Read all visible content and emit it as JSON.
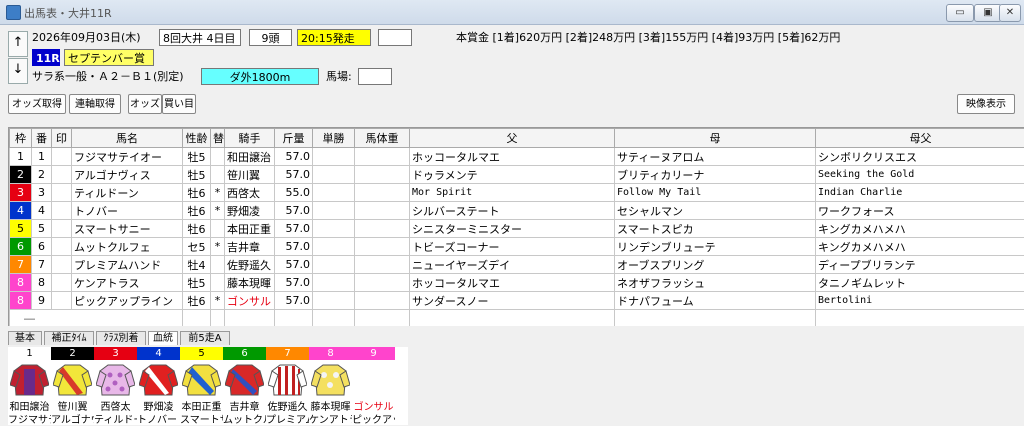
{
  "window": {
    "title": "出馬表・大井11R",
    "min_label": "▭",
    "max_label": "▣",
    "close_label": "✕"
  },
  "race": {
    "up_label": "↑",
    "down_label": "↓",
    "date": "2026年09月03日(木)",
    "meeting": "8回大井 4日目",
    "heads": "9頭",
    "start": "20:15発走",
    "extra": "",
    "race_no": "11R",
    "race_name": "セプテンバー賞",
    "conditions": "サラ系一般・Ａ２－Ｂ１(別定)",
    "course": "ダ外1800m",
    "baba_label": "馬場:",
    "baba_value": "",
    "prize": "本賞金 [1着]620万円 [2着]248万円 [3着]155万円 [4着]93万円 [5着]62万円"
  },
  "toolbar": {
    "odds_fetch": "オッズ取得",
    "ren_fetch": "連軸取得",
    "odds": "オッズ",
    "buy": "買い目",
    "video": "映像表示"
  },
  "table": {
    "headers": [
      "枠",
      "番",
      "印",
      "馬名",
      "性齢",
      "替",
      "騎手",
      "斤量",
      "単勝",
      "馬体重",
      "父",
      "母",
      "母父"
    ],
    "rows": [
      {
        "waku": "1",
        "ban": "1",
        "mark": "",
        "name": "フジマサテイオー",
        "sexage": "牡5",
        "kae": "",
        "jockey": "和田譲治",
        "kinryo": "57.0",
        "odds": "",
        "weight": "",
        "sire": "ホッコータルマエ",
        "dam": "サティーヌアロム",
        "damsire": "シンボリクリスエス"
      },
      {
        "waku": "2",
        "ban": "2",
        "mark": "",
        "name": "アルゴナヴィス",
        "sexage": "牡5",
        "kae": "",
        "jockey": "笹川翼",
        "kinryo": "57.0",
        "odds": "",
        "weight": "",
        "sire": "ドゥラメンテ",
        "dam": "ブリティカリーナ",
        "damsire": "Seeking the Gold"
      },
      {
        "waku": "3",
        "ban": "3",
        "mark": "",
        "name": "ティルドーン",
        "sexage": "牡6",
        "kae": "*",
        "jockey": "西啓太",
        "kinryo": "55.0",
        "odds": "",
        "weight": "",
        "sire": "Mor Spirit",
        "dam": "Follow My Tail",
        "damsire": "Indian Charlie"
      },
      {
        "waku": "4",
        "ban": "4",
        "mark": "",
        "name": "トノバー",
        "sexage": "牡6",
        "kae": "*",
        "jockey": "野畑凌",
        "kinryo": "57.0",
        "odds": "",
        "weight": "",
        "sire": "シルバーステート",
        "dam": "セシャルマン",
        "damsire": "ワークフォース"
      },
      {
        "waku": "5",
        "ban": "5",
        "mark": "",
        "name": "スマートサニー",
        "sexage": "牡6",
        "kae": "",
        "jockey": "本田正重",
        "kinryo": "57.0",
        "odds": "",
        "weight": "",
        "sire": "シニスターミニスター",
        "dam": "スマートスピカ",
        "damsire": "キングカメハメハ"
      },
      {
        "waku": "6",
        "ban": "6",
        "mark": "",
        "name": "ムットクルフェ",
        "sexage": "セ5",
        "kae": "*",
        "jockey": "吉井章",
        "kinryo": "57.0",
        "odds": "",
        "weight": "",
        "sire": "トビーズコーナー",
        "dam": "リンデンブリューテ",
        "damsire": "キングカメハメハ"
      },
      {
        "waku": "7",
        "ban": "7",
        "mark": "",
        "name": "プレミアムハンド",
        "sexage": "牡4",
        "kae": "",
        "jockey": "佐野遥久",
        "kinryo": "57.0",
        "odds": "",
        "weight": "",
        "sire": "ニューイヤーズデイ",
        "dam": "オーブスプリング",
        "damsire": "ディープブリランテ"
      },
      {
        "waku": "8",
        "ban": "8",
        "mark": "",
        "name": "ケンアトラス",
        "sexage": "牡5",
        "kae": "",
        "jockey": "藤本現暉",
        "kinryo": "57.0",
        "odds": "",
        "weight": "",
        "sire": "ホッコータルマエ",
        "dam": "ネオザフラッシュ",
        "damsire": "タニノギムレット"
      },
      {
        "waku": "8",
        "ban": "9",
        "mark": "",
        "name": "ピックアップライン",
        "sexage": "牡6",
        "kae": "*",
        "jockey": "ゴンサル",
        "kinryo": "57.0",
        "odds": "",
        "weight": "",
        "sire": "サンダースノー",
        "dam": "ドナパフューム",
        "damsire": "Bertolini"
      }
    ],
    "empty_row": "―"
  },
  "tabs": [
    "基本",
    "補正ﾀｲﾑ",
    "ｸﾗｽ別着",
    "血統",
    "前5走A"
  ],
  "silks": [
    {
      "num": "1",
      "jockey": "和田譲治",
      "horse": "フジマサテイ",
      "color": "#ffffff",
      "text": "#000000",
      "body": "#c02030",
      "accent": "#6a2a8a"
    },
    {
      "num": "2",
      "jockey": "笹川翼",
      "horse": "アルゴナヴィ",
      "color": "#000000",
      "text": "#ffffff",
      "body": "#f2e63a",
      "accent": "#d83a2a"
    },
    {
      "num": "3",
      "jockey": "西啓太",
      "horse": "ティルドーン",
      "color": "#e60012",
      "text": "#ffffff",
      "body": "#e8b8e8",
      "accent": "#b060c0"
    },
    {
      "num": "4",
      "jockey": "野畑凌",
      "horse": "トノバー",
      "color": "#0033cc",
      "text": "#ffffff",
      "body": "#e02020",
      "accent": "#ffffff"
    },
    {
      "num": "5",
      "jockey": "本田正重",
      "horse": "スマートサニー",
      "color": "#ffff00",
      "text": "#000000",
      "body": "#f2e040",
      "accent": "#2060d0"
    },
    {
      "num": "6",
      "jockey": "吉井章",
      "horse": "ムットクルフェ",
      "color": "#009900",
      "text": "#ffffff",
      "body": "#d82828",
      "accent": "#3050c0"
    },
    {
      "num": "7",
      "jockey": "佐野遥久",
      "horse": "プレミアム",
      "color": "#ff8800",
      "text": "#ffffff",
      "body": "#ffffff",
      "accent": "#c02020"
    },
    {
      "num": "8",
      "jockey": "藤本現暉",
      "horse": "ケンアトラス",
      "color": "#ff44cc",
      "text": "#ffffff",
      "body": "#f4e060",
      "accent": "#f4f4f4"
    },
    {
      "num": "9",
      "jockey": "ゴンサル",
      "horse": "ピックアップ",
      "color": "#ff44cc",
      "text": "#ffffff",
      "body": "#ffffff",
      "accent": "#ffffff"
    }
  ],
  "waku_colors": {
    "1": {
      "bg": "#ffffff",
      "fg": "#000000"
    },
    "2": {
      "bg": "#000000",
      "fg": "#ffffff"
    },
    "3": {
      "bg": "#e60012",
      "fg": "#ffffff"
    },
    "4": {
      "bg": "#0033cc",
      "fg": "#ffffff"
    },
    "5": {
      "bg": "#ffff00",
      "fg": "#000000"
    },
    "6": {
      "bg": "#009900",
      "fg": "#ffffff"
    },
    "7": {
      "bg": "#ff8800",
      "fg": "#ffffff"
    },
    "8": {
      "bg": "#ff44cc",
      "fg": "#ffffff"
    }
  },
  "accent_colors": {
    "race_no_bg": "#0000cc",
    "race_name_bg": "#ffff66",
    "start_bg": "#ffff00",
    "course_bg": "#66ffff",
    "highlight_jockey": "#e60012"
  }
}
